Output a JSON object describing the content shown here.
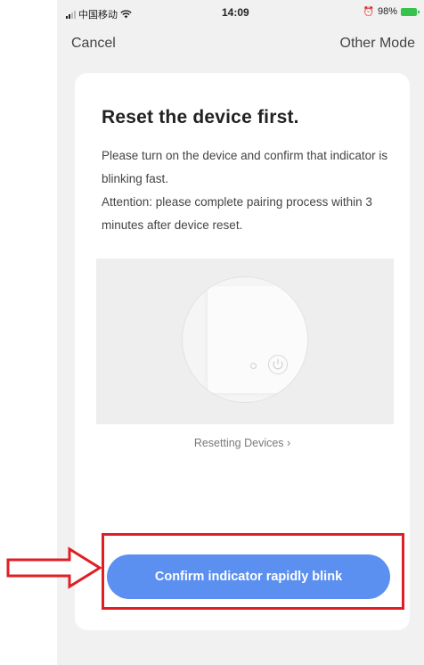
{
  "status_bar": {
    "carrier": "中国移动",
    "time": "14:09",
    "battery_percent": "98%"
  },
  "nav": {
    "cancel_label": "Cancel",
    "other_mode_label": "Other Mode"
  },
  "card": {
    "title": "Reset the device first.",
    "description_line1": "Please turn on the device and confirm that indicator is blinking fast.",
    "description_line2": "Attention: please complete pairing process within 3 minutes after device reset.",
    "resetting_link": "Resetting Devices ›",
    "confirm_button": "Confirm indicator rapidly blink"
  },
  "colors": {
    "accent_button": "#5b8ff0",
    "annotation_red": "#e01f25",
    "battery_green": "#36c24c"
  }
}
